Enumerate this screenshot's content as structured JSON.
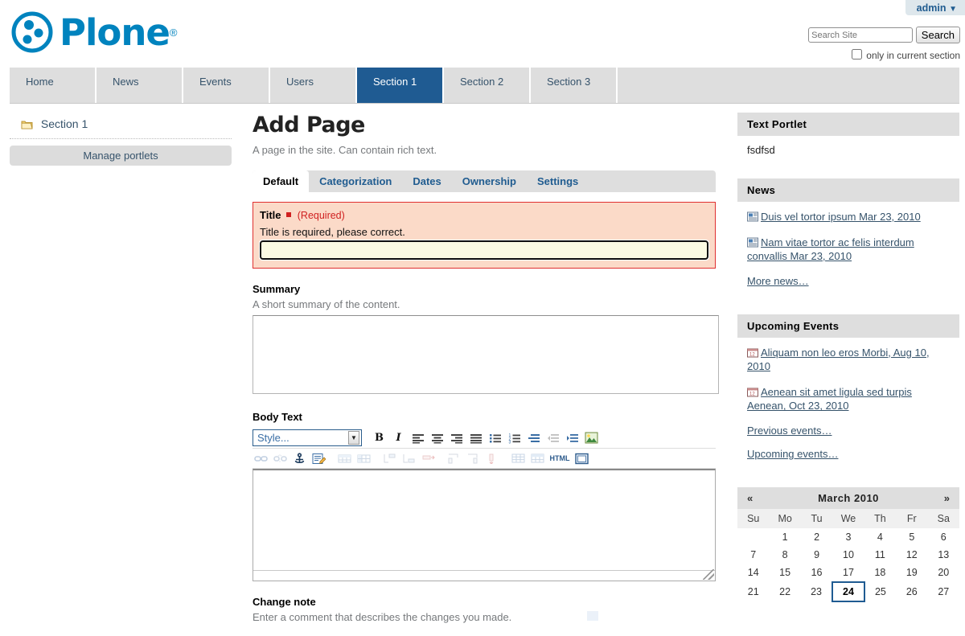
{
  "personal_bar": {
    "user": "admin",
    "caret": "▼"
  },
  "brand": {
    "name": "Plone",
    "registered": "®",
    "logo_icon": "plone-logo-icon"
  },
  "search": {
    "value": "",
    "placeholder": "Search Site",
    "button_label": "Search",
    "checkbox_label": "only in current section",
    "checked": false
  },
  "globalnav": {
    "items": [
      {
        "label": "Home",
        "selected": false
      },
      {
        "label": "News",
        "selected": false
      },
      {
        "label": "Events",
        "selected": false
      },
      {
        "label": "Users",
        "selected": false
      },
      {
        "label": "Section 1",
        "selected": true
      },
      {
        "label": "Section 2",
        "selected": false
      },
      {
        "label": "Section 3",
        "selected": false
      }
    ]
  },
  "left_column": {
    "nav_item": {
      "label": "Section 1",
      "icon": "folder-icon"
    },
    "manage_portlets_label": "Manage portlets"
  },
  "main": {
    "title": "Add Page",
    "description": "A page in the site. Can contain rich text.",
    "tabs": [
      {
        "label": "Default",
        "active": true
      },
      {
        "label": "Categorization",
        "active": false
      },
      {
        "label": "Dates",
        "active": false
      },
      {
        "label": "Ownership",
        "active": false
      },
      {
        "label": "Settings",
        "active": false
      }
    ],
    "title_field": {
      "label": "Title",
      "required_marker": "■",
      "required_text": "(Required)",
      "error_message": "Title is required, please correct.",
      "value": "",
      "placeholder": ""
    },
    "summary_field": {
      "label": "Summary",
      "hint": "A short summary of the content.",
      "value": ""
    },
    "body_field": {
      "label": "Body Text",
      "value": "",
      "style_select": {
        "value": "Style...",
        "arrow": "▼"
      },
      "toolbar_row1": [
        {
          "name": "bold-icon",
          "glyph": "B",
          "kind": "b",
          "disabled": false
        },
        {
          "name": "italic-icon",
          "glyph": "I",
          "kind": "i",
          "disabled": false
        },
        {
          "name": "align-left-icon",
          "glyph": "align-left",
          "kind": "svg",
          "disabled": false
        },
        {
          "name": "align-center-icon",
          "glyph": "align-center",
          "kind": "svg",
          "disabled": false
        },
        {
          "name": "align-right-icon",
          "glyph": "align-right",
          "kind": "svg",
          "disabled": false
        },
        {
          "name": "align-justify-icon",
          "glyph": "align-justify",
          "kind": "svg",
          "disabled": false
        },
        {
          "name": "bullet-list-icon",
          "glyph": "ul",
          "kind": "svg",
          "disabled": false
        },
        {
          "name": "numbered-list-icon",
          "glyph": "ol",
          "kind": "svg",
          "disabled": false
        },
        {
          "name": "definition-list-icon",
          "glyph": "dl",
          "kind": "svg",
          "disabled": false
        },
        {
          "name": "outdent-icon",
          "glyph": "outdent",
          "kind": "svg",
          "disabled": true
        },
        {
          "name": "indent-icon",
          "glyph": "indent",
          "kind": "svg",
          "disabled": false
        },
        {
          "name": "insert-image-icon",
          "glyph": "image",
          "kind": "svg",
          "disabled": false
        }
      ],
      "toolbar_row2": [
        {
          "name": "insert-link-icon",
          "glyph": "link",
          "kind": "svg",
          "disabled": true
        },
        {
          "name": "unlink-icon",
          "glyph": "unlink",
          "kind": "svg",
          "disabled": true
        },
        {
          "name": "anchor-icon",
          "glyph": "anchor",
          "kind": "svg",
          "disabled": false
        },
        {
          "name": "edit-style-icon",
          "glyph": "pencil",
          "kind": "svg",
          "disabled": false
        },
        {
          "name": "table-row-properties-icon",
          "glyph": "trow",
          "kind": "svg",
          "disabled": true
        },
        {
          "name": "table-cell-properties-icon",
          "glyph": "tcell",
          "kind": "svg",
          "disabled": true
        },
        {
          "name": "insert-row-before-icon",
          "glyph": "rowbefore",
          "kind": "svg",
          "disabled": true
        },
        {
          "name": "insert-row-after-icon",
          "glyph": "rowafter",
          "kind": "svg",
          "disabled": true
        },
        {
          "name": "delete-row-icon",
          "glyph": "rowdel",
          "kind": "svg",
          "disabled": true
        },
        {
          "name": "insert-column-before-icon",
          "glyph": "colbefore",
          "kind": "svg",
          "disabled": true
        },
        {
          "name": "insert-column-after-icon",
          "glyph": "colafter",
          "kind": "svg",
          "disabled": true
        },
        {
          "name": "delete-column-icon",
          "glyph": "coldel",
          "kind": "svg",
          "disabled": true
        },
        {
          "name": "insert-table-icon",
          "glyph": "table",
          "kind": "svg",
          "disabled": true
        },
        {
          "name": "table-properties-icon",
          "glyph": "tableprops",
          "kind": "svg",
          "disabled": true
        },
        {
          "name": "edit-html-icon",
          "glyph": "HTML",
          "kind": "html",
          "disabled": false
        },
        {
          "name": "fullscreen-icon",
          "glyph": "fullscreen",
          "kind": "svg",
          "disabled": false
        }
      ]
    },
    "change_note": {
      "label": "Change note",
      "hint": "Enter a comment that describes the changes you made."
    }
  },
  "right_column": {
    "text_portlet": {
      "title": "Text Portlet",
      "body": "fsdfsd"
    },
    "news_portlet": {
      "title": "News",
      "items": [
        {
          "icon": "news-item-icon",
          "text": "Duis vel tortor ipsum Mar 23, 2010"
        },
        {
          "icon": "news-item-icon",
          "text": "Nam vitae tortor ac felis interdum convallis Mar 23, 2010"
        }
      ],
      "more_link": "More news…"
    },
    "events_portlet": {
      "title": "Upcoming Events",
      "items": [
        {
          "icon": "event-item-icon",
          "text": "Aliquam non leo eros Morbi, Aug 10, 2010"
        },
        {
          "icon": "event-item-icon",
          "text": "Aenean sit amet ligula sed turpis Aenean, Oct 23, 2010"
        }
      ],
      "previous_link": "Previous events…",
      "upcoming_link": "Upcoming events…"
    },
    "calendar_portlet": {
      "prev": "«",
      "next": "»",
      "title": "March 2010",
      "weekdays": [
        "Su",
        "Mo",
        "Tu",
        "We",
        "Th",
        "Fr",
        "Sa"
      ],
      "weeks": [
        [
          "",
          "1",
          "2",
          "3",
          "4",
          "5",
          "6"
        ],
        [
          "7",
          "8",
          "9",
          "10",
          "11",
          "12",
          "13"
        ],
        [
          "14",
          "15",
          "16",
          "17",
          "18",
          "19",
          "20"
        ],
        [
          "21",
          "22",
          "23",
          "24",
          "25",
          "26",
          "27"
        ]
      ],
      "today": "24"
    }
  },
  "colors": {
    "brand_blue": "#0083be",
    "active_tab": "#1f5b92",
    "nav_bg": "#dedede",
    "link": "#36536b",
    "error_border": "#e03030",
    "error_bg": "#fbdac8",
    "required_red": "#d02020",
    "input_yellow": "#fbfbe3"
  }
}
